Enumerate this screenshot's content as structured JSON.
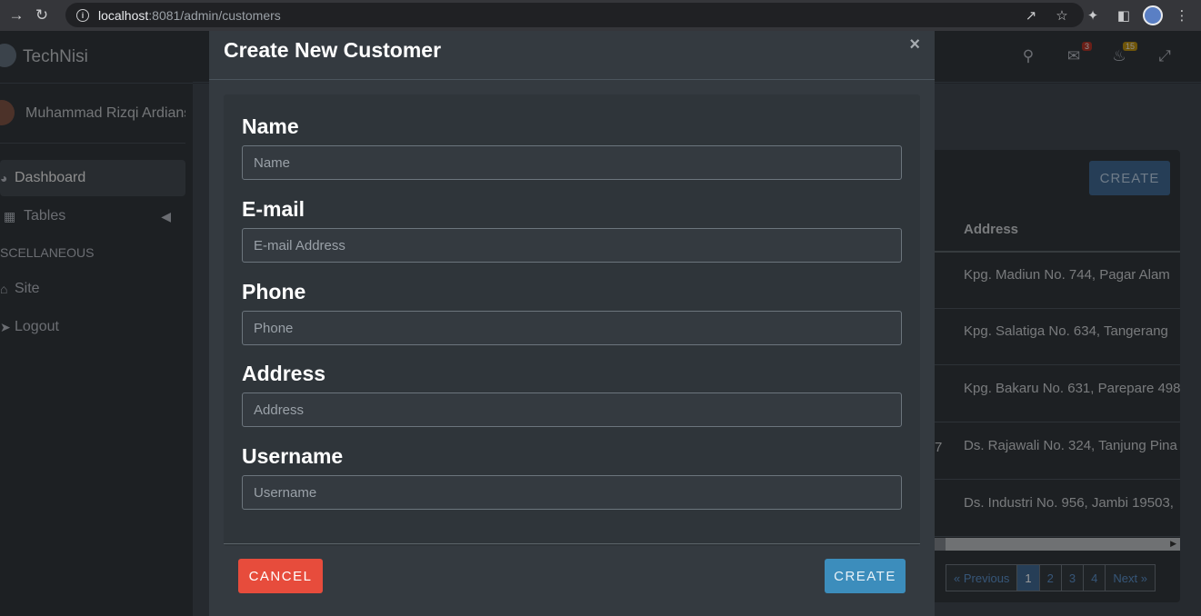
{
  "browser": {
    "url_host": "localhost",
    "url_rest": ":8081/admin/customers"
  },
  "sidebar": {
    "brand": "TechNisi",
    "user_name": "Muhammad Rizqi Ardians",
    "items": [
      {
        "label": "Dashboard",
        "icon": "dashboard-icon"
      },
      {
        "label": "Tables",
        "icon": "table-icon"
      }
    ],
    "section_header": "SCELLANEOUS",
    "misc_items": [
      {
        "label": "Site",
        "icon": "home-icon"
      },
      {
        "label": "Logout",
        "icon": "logout-icon"
      }
    ]
  },
  "topbar": {
    "messages_badge": "3",
    "notifications_badge": "15"
  },
  "page": {
    "create_label": "CREATE",
    "column_address": "Address",
    "rows": [
      "Kpg. Madiun No. 744, Pagar Alam",
      "Kpg. Salatiga No. 634, Tangerang",
      "Kpg. Bakaru No. 631, Parepare 498",
      "Ds. Rajawali No. 324, Tanjung Pina",
      "Ds. Industri No. 956, Jambi 19503,"
    ],
    "row_stub": "7",
    "pagination": [
      "« Previous",
      "1",
      "2",
      "3",
      "4",
      "Next »"
    ]
  },
  "modal": {
    "title": "Create New Customer",
    "close": "×",
    "fields": [
      {
        "label": "Name",
        "placeholder": "Name"
      },
      {
        "label": "E-mail",
        "placeholder": "E-mail Address"
      },
      {
        "label": "Phone",
        "placeholder": "Phone"
      },
      {
        "label": "Address",
        "placeholder": "Address"
      },
      {
        "label": "Username",
        "placeholder": "Username"
      }
    ],
    "cancel_label": "CANCEL",
    "create_label": "CREATE"
  },
  "colors": {
    "cancel": "#e74c3c",
    "primary": "#3c8dbc",
    "modal_bg": "#343a40"
  }
}
